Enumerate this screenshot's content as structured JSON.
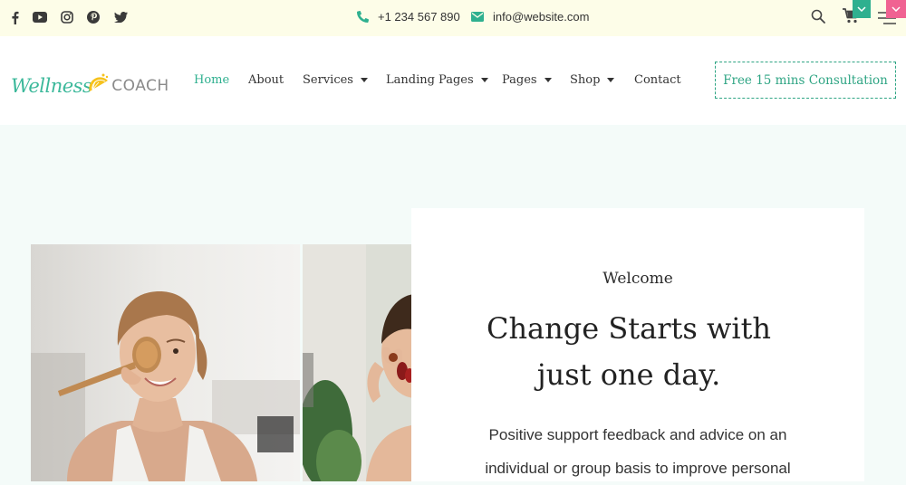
{
  "topbar": {
    "social": [
      "facebook-icon",
      "youtube-icon",
      "instagram-icon",
      "pinterest-icon",
      "twitter-icon"
    ],
    "phone": "+1 234 567 890",
    "email": "info@website.com",
    "accent_colors": {
      "teal": "#2fb08f",
      "pink": "#f06292",
      "bg": "#fdfde8"
    }
  },
  "logo": {
    "script": "Wellness",
    "word": "COACH"
  },
  "nav": {
    "home": "Home",
    "about": "About",
    "services": "Services",
    "landing": "Landing Pages",
    "pages": "Pages",
    "shop": "Shop",
    "contact": "Contact"
  },
  "cta": {
    "label": "Free 15 mins Consultation"
  },
  "hero": {
    "eyebrow": "Welcome",
    "headline_line1": "Change Starts with",
    "headline_line2": "just one day.",
    "description_line1": "Positive support feedback and advice on an",
    "description_line2": "individual or group basis to improve personal"
  }
}
